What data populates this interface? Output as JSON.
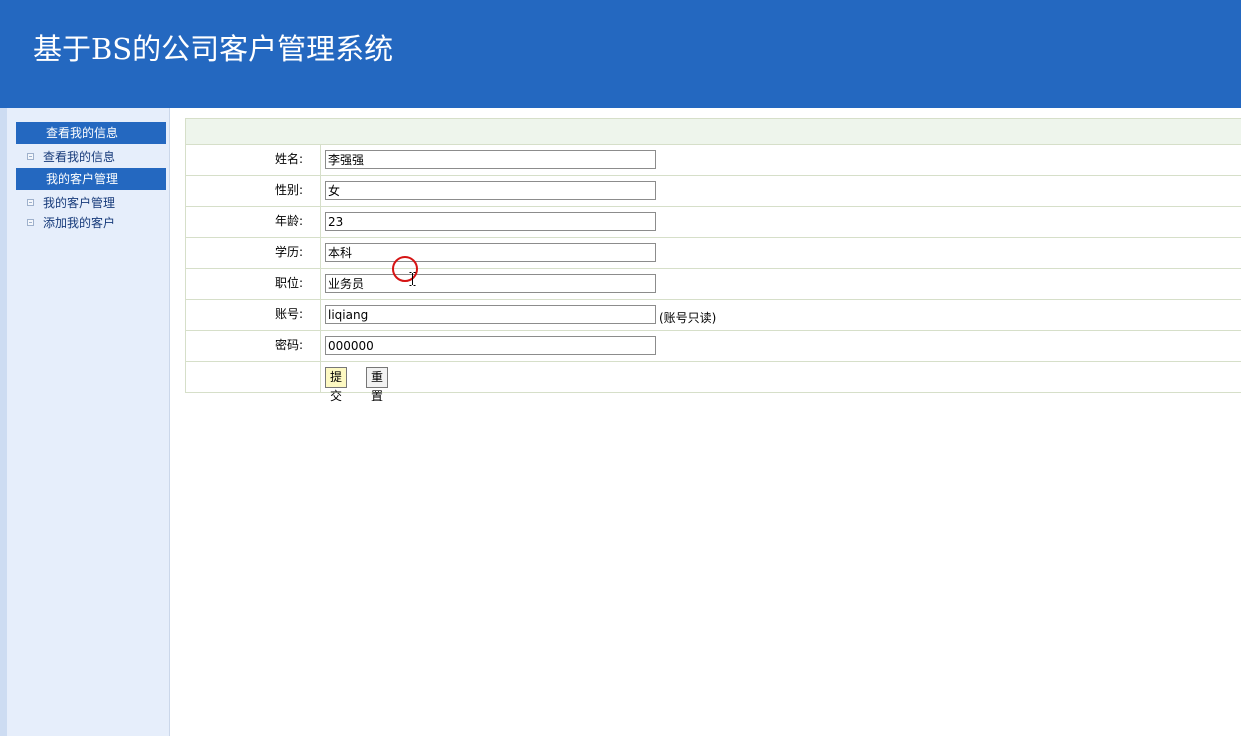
{
  "header": {
    "title": "基于BS的公司客户管理系统"
  },
  "sidebar": {
    "groups": [
      {
        "title": "查看我的信息",
        "items": [
          {
            "label": "查看我的信息"
          }
        ]
      },
      {
        "title": "我的客户管理",
        "items": [
          {
            "label": "我的客户管理"
          },
          {
            "label": "添加我的客户"
          }
        ]
      }
    ]
  },
  "form": {
    "fields": [
      {
        "label": "姓名:",
        "value": "李强强"
      },
      {
        "label": "性别:",
        "value": "女"
      },
      {
        "label": "年龄:",
        "value": "23"
      },
      {
        "label": "学历:",
        "value": "本科"
      },
      {
        "label": "职位:",
        "value": "业务员"
      },
      {
        "label": "账号:",
        "value": "liqiang",
        "note": "(账号只读)"
      },
      {
        "label": "密码:",
        "value": "000000"
      }
    ],
    "submit_label": "提交",
    "reset_label": "重置"
  },
  "colors": {
    "header_bg": "#2468c0",
    "sidebar_bg": "#e6eefb",
    "form_head_bg": "#eef5ec",
    "border": "#d6dfc9",
    "submit_bg": "#fdf9c2"
  }
}
